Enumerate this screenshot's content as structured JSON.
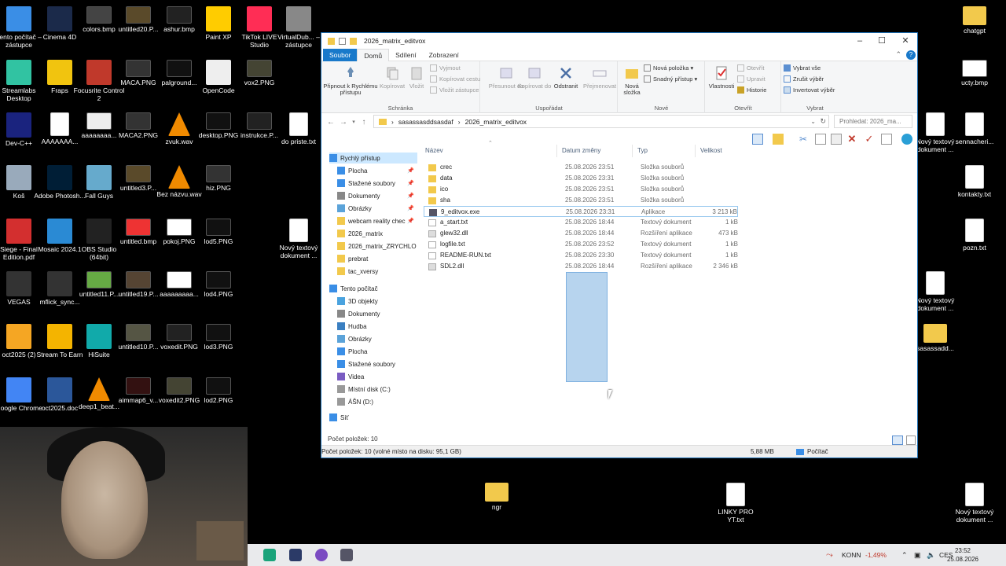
{
  "desktop": {
    "icons": [
      {
        "label": "Tento počítač – zástupce",
        "icon": "computer-icon",
        "color": "#3a8ee6"
      },
      {
        "label": "Cinema 4D",
        "icon": "cinema4d-icon",
        "color": "#1b2a4a"
      },
      {
        "label": "colors.bmp",
        "icon": "image-icon",
        "color": "#444"
      },
      {
        "label": "untitled20.P...",
        "icon": "image-icon",
        "color": "#5a4a2a"
      },
      {
        "label": "ashur.bmp",
        "icon": "image-icon",
        "color": "#222"
      },
      {
        "label": "Paint XP",
        "icon": "paint-icon",
        "color": "#ffcc00"
      },
      {
        "label": "TikTok LIVE Studio",
        "icon": "tiktok-icon",
        "color": "#ff2d55"
      },
      {
        "label": "VirtualDub... – zástupce",
        "icon": "virtualdub-icon",
        "color": "#888"
      },
      {
        "label": "Streamlabs Desktop",
        "icon": "streamlabs-icon",
        "color": "#31c3a2"
      },
      {
        "label": "Fraps",
        "icon": "fraps-icon",
        "color": "#f1c40f"
      },
      {
        "label": "Focusrite Control 2",
        "icon": "focusrite-icon",
        "color": "#c0392b"
      },
      {
        "label": "MACA.PNG",
        "icon": "image-icon",
        "color": "#333"
      },
      {
        "label": "palground...",
        "icon": "image-icon",
        "color": "#111"
      },
      {
        "label": "OpenCode",
        "icon": "opencode-icon",
        "color": "#eee"
      },
      {
        "label": "vox2.PNG",
        "icon": "image-icon",
        "color": "#443"
      },
      {
        "label": "Dev-C++",
        "icon": "devcpp-icon",
        "color": "#1a237e"
      },
      {
        "label": "AAAAAAA...",
        "icon": "document-icon",
        "color": "#fff"
      },
      {
        "label": "aaaaaaaa...",
        "icon": "image-icon",
        "color": "#eee"
      },
      {
        "label": "MACA2.PNG",
        "icon": "image-icon",
        "color": "#333"
      },
      {
        "label": "zvuk.wav",
        "icon": "vlc-icon",
        "color": "#f08a00"
      },
      {
        "label": "desktop.PNG",
        "icon": "image-icon",
        "color": "#111"
      },
      {
        "label": "instrukce.P...",
        "icon": "image-icon",
        "color": "#222"
      },
      {
        "label": "do priste.txt",
        "icon": "document-icon",
        "color": "#fff"
      },
      {
        "label": "Koš",
        "icon": "recycle-bin-icon",
        "color": "#9ab"
      },
      {
        "label": "Adobe Photosh...",
        "icon": "photoshop-icon",
        "color": "#001e36"
      },
      {
        "label": "Fall Guys",
        "icon": "fallguys-icon",
        "color": "#6ac"
      },
      {
        "label": "untitled3.P...",
        "icon": "image-icon",
        "color": "#5a4a2a"
      },
      {
        "label": "Bez názvu.wav",
        "icon": "vlc-icon",
        "color": "#f08a00"
      },
      {
        "label": "hiz.PNG",
        "icon": "image-icon",
        "color": "#333"
      },
      {
        "label": "Siege - Final Edition.pdf",
        "icon": "pdf-icon",
        "color": "#d32f2f"
      },
      {
        "label": "Mosaic 2024.1",
        "icon": "mosaic-icon",
        "color": "#2a8ad4"
      },
      {
        "label": "OBS Studio (64bit)",
        "icon": "obs-icon",
        "color": "#222"
      },
      {
        "label": "untitled.bmp",
        "icon": "image-icon",
        "color": "#e33"
      },
      {
        "label": "pokoj.PNG",
        "icon": "image-icon",
        "color": "#fff"
      },
      {
        "label": "lod5.PNG",
        "icon": "image-icon",
        "color": "#111"
      },
      {
        "label": "Nový textový dokument ...",
        "icon": "document-icon",
        "color": "#fff"
      },
      {
        "label": "VEGAS",
        "icon": "vegas-icon",
        "color": "#333"
      },
      {
        "label": "mflick_sync...",
        "icon": "video-icon",
        "color": "#333"
      },
      {
        "label": "untitled11.P...",
        "icon": "image-icon",
        "color": "#6a4"
      },
      {
        "label": "untitled19.P...",
        "icon": "image-icon",
        "color": "#543"
      },
      {
        "label": "aaaaaaaaa...",
        "icon": "image-icon",
        "color": "#fff"
      },
      {
        "label": "lod4.PNG",
        "icon": "image-icon",
        "color": "#111"
      },
      {
        "label": "oct2025 (2)",
        "icon": "flstudio-icon",
        "color": "#f5a623"
      },
      {
        "label": "Stream To Earn",
        "icon": "streamtoearn-icon",
        "color": "#f4b400"
      },
      {
        "label": "HiSuite",
        "icon": "hisuite-icon",
        "color": "#1aa"
      },
      {
        "label": "untitled10.P...",
        "icon": "image-icon",
        "color": "#554"
      },
      {
        "label": "voxedit.PNG",
        "icon": "image-icon",
        "color": "#222"
      },
      {
        "label": "lod3.PNG",
        "icon": "image-icon",
        "color": "#111"
      },
      {
        "label": "Google Chrome",
        "icon": "chrome-icon",
        "color": "#4285f4"
      },
      {
        "label": "oct2025.doc",
        "icon": "word-doc-icon",
        "color": "#2b579a"
      },
      {
        "label": "deep1_beat...",
        "icon": "vlc-icon",
        "color": "#f08a00"
      },
      {
        "label": "aimmap6_v...",
        "icon": "image-icon",
        "color": "#311"
      },
      {
        "label": "voxedit2.PNG",
        "icon": "image-icon",
        "color": "#443"
      },
      {
        "label": "lod2.PNG",
        "icon": "image-icon",
        "color": "#111"
      },
      {
        "label": "chatgpt",
        "icon": "folder-icon",
        "color": "#f2c94c"
      },
      {
        "label": "ucty.bmp",
        "icon": "image-icon",
        "color": "#fff"
      },
      {
        "label": "Nový textový dokument ...",
        "icon": "document-icon",
        "color": "#fff"
      },
      {
        "label": "sennacheri...",
        "icon": "document-icon",
        "color": "#fff"
      },
      {
        "label": "kontakty.txt",
        "icon": "document-icon",
        "color": "#fff"
      },
      {
        "label": "pozn.txt",
        "icon": "document-icon",
        "color": "#fff"
      },
      {
        "label": "Nový textový dokument ...",
        "icon": "document-icon",
        "color": "#fff"
      },
      {
        "label": "sasassadd...",
        "icon": "folder-icon",
        "color": "#f2c94c"
      },
      {
        "label": "ngr",
        "icon": "folder-icon",
        "color": "#f2c94c"
      },
      {
        "label": "LINKY PRO YT.txt",
        "icon": "document-icon",
        "color": "#fff"
      },
      {
        "label": "Nový textový dokument ...",
        "icon": "document-icon",
        "color": "#fff"
      }
    ]
  },
  "explorer": {
    "title": "2026_matrix_editvox",
    "tabs": [
      "Soubor",
      "Domů",
      "Sdílení",
      "Zobrazení"
    ],
    "ribbon": {
      "pin_label": "Připnout k Rychlému přístupu",
      "copy_label": "Kopírovat",
      "paste_label": "Vložit",
      "cut_label": "Vyjmout",
      "copy_path_label": "Kopírovat cestu",
      "paste_shortcut_label": "Vložit zástupce",
      "group_clipboard": "Schránka",
      "move_label": "Přesunout do",
      "copyto_label": "Kopírovat do",
      "delete_label": "Odstranit",
      "rename_label": "Přejmenovat",
      "group_organize": "Uspořádat",
      "new_folder_label": "Nová složka",
      "new_item_label": "Nová položka",
      "easy_access_label": "Snadný přístup",
      "group_new": "Nové",
      "properties_label": "Vlastnosti",
      "open_label": "Otevřít",
      "edit_label": "Upravit",
      "history_label": "Historie",
      "group_open": "Otevřít",
      "select_all_label": "Vybrat vše",
      "select_none_label": "Zrušit výběr",
      "invert_label": "Invertovat výběr",
      "group_select": "Vybrat"
    },
    "address": {
      "crumbs": [
        "sasassasddsasdaf",
        "2026_matrix_editvox"
      ],
      "search_placeholder": "Prohledat: 2026_ma..."
    },
    "nav": {
      "quick_access": "Rychlý přístup",
      "items": [
        {
          "label": "Plocha",
          "pinned": true
        },
        {
          "label": "Stažené soubory",
          "pinned": true
        },
        {
          "label": "Dokumenty",
          "pinned": true
        },
        {
          "label": "Obrázky",
          "pinned": true
        },
        {
          "label": "webcam reality chec",
          "pinned": true
        },
        {
          "label": "2026_matrix",
          "pinned": false
        },
        {
          "label": "2026_matrix_ZRYCHLO",
          "pinned": false
        },
        {
          "label": "prebrat",
          "pinned": false
        },
        {
          "label": "tac_xversy",
          "pinned": false
        }
      ],
      "this_pc": "Tento počítač",
      "pc_items": [
        "3D objekty",
        "Dokumenty",
        "Hudba",
        "Obrázky",
        "Plocha",
        "Stažené soubory",
        "Videa",
        "Místní disk (C:)",
        "ÁŠN (D:)"
      ],
      "network": "Síť"
    },
    "columns": {
      "name": "Název",
      "date": "Datum změny",
      "type": "Typ",
      "size": "Velikost"
    },
    "files": [
      {
        "name": "crec",
        "date": "25.08.2026 23:51",
        "type": "Složka souborů",
        "size": "",
        "kind": "folder"
      },
      {
        "name": "data",
        "date": "25.08.2026 23:31",
        "type": "Složka souborů",
        "size": "",
        "kind": "folder"
      },
      {
        "name": "ico",
        "date": "25.08.2026 23:51",
        "type": "Složka souborů",
        "size": "",
        "kind": "folder"
      },
      {
        "name": "sha",
        "date": "25.08.2026 23:51",
        "type": "Složka souborů",
        "size": "",
        "kind": "folder"
      },
      {
        "name": "9_editvox.exe",
        "date": "25.08.2026 23:31",
        "type": "Aplikace",
        "size": "3 213 kB",
        "kind": "exe"
      },
      {
        "name": "a_start.txt",
        "date": "25.08.2026 18:44",
        "type": "Textový dokument",
        "size": "1 kB",
        "kind": "txt"
      },
      {
        "name": "glew32.dll",
        "date": "25.08.2026 18:44",
        "type": "Rozšíření aplikace",
        "size": "473 kB",
        "kind": "dll"
      },
      {
        "name": "logfile.txt",
        "date": "25.08.2026 23:52",
        "type": "Textový dokument",
        "size": "1 kB",
        "kind": "txt"
      },
      {
        "name": "README-RUN.txt",
        "date": "25.08.2026 23:30",
        "type": "Textový dokument",
        "size": "1 kB",
        "kind": "txt"
      },
      {
        "name": "SDL2.dll",
        "date": "25.08.2026 18:44",
        "type": "Rozšíření aplikace",
        "size": "2 346 kB",
        "kind": "dll"
      }
    ],
    "inner_status": "Počet položek: 10",
    "status_left": "Počet položek: 10 (volné místo na disku: 95,1 GB)",
    "status_size": "5,88 MB",
    "status_pc": "Počítač"
  },
  "taskbar": {
    "stock_name": "KONN",
    "stock_change": "-1,49%",
    "lang": "CES",
    "time": "23:52",
    "date": "25.08.2026"
  }
}
